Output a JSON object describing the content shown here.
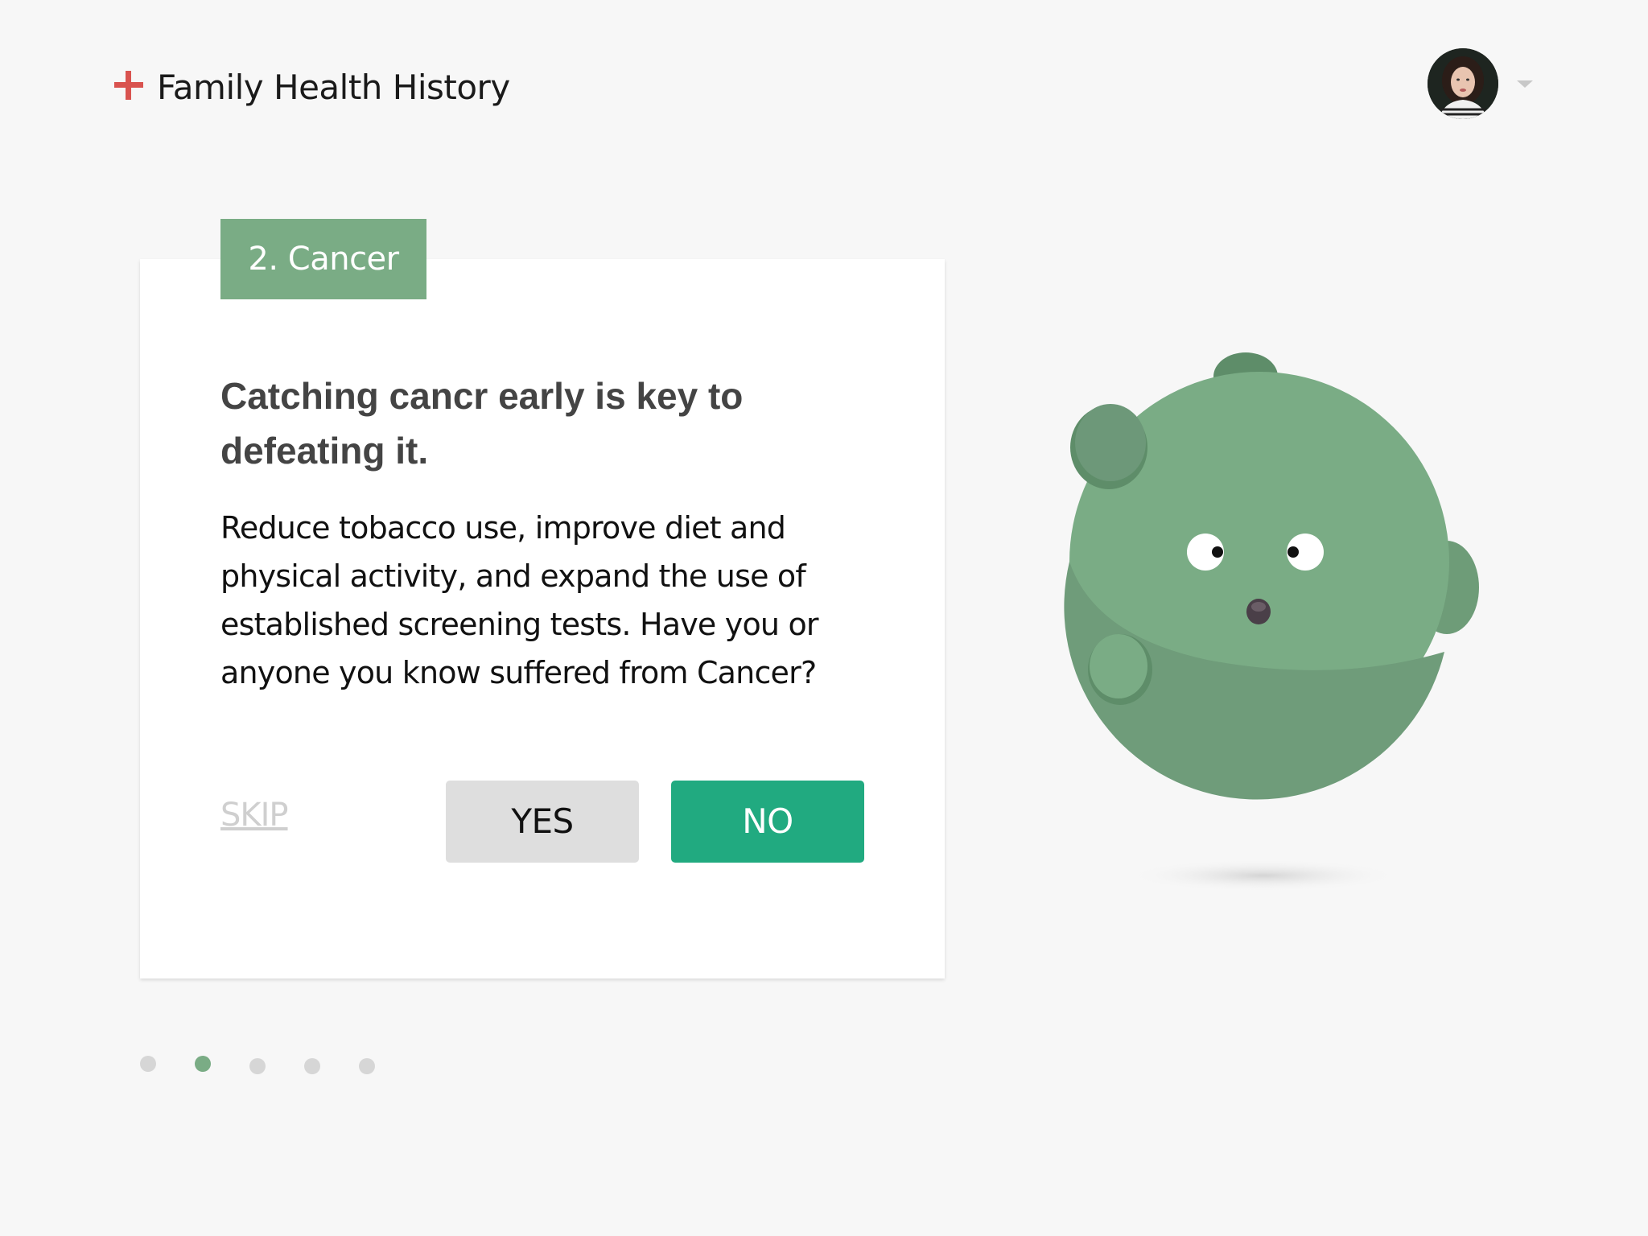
{
  "header": {
    "app_title": "Family Health History",
    "logo_icon": "plus-cross-icon",
    "logo_color": "#d9534f"
  },
  "user_menu": {
    "avatar_icon": "user-avatar",
    "dropdown_icon": "chevron-down-icon"
  },
  "question_card": {
    "step_label": "2. Cancer",
    "headline": "Catching cancr early is key to defeating it.",
    "body": "Reduce tobacco use, improve diet and physical activity, and expand the use of established screening tests. Have you or anyone you know suffered from Cancer?",
    "skip_label": "SKIP",
    "yes_label": "YES",
    "no_label": "NO"
  },
  "pagination": {
    "total_steps": 5,
    "current_step": 2
  },
  "colors": {
    "accent_green": "#7aac85",
    "primary_button": "#21aa80",
    "secondary_button": "#dedede",
    "background": "#f7f7f7"
  }
}
